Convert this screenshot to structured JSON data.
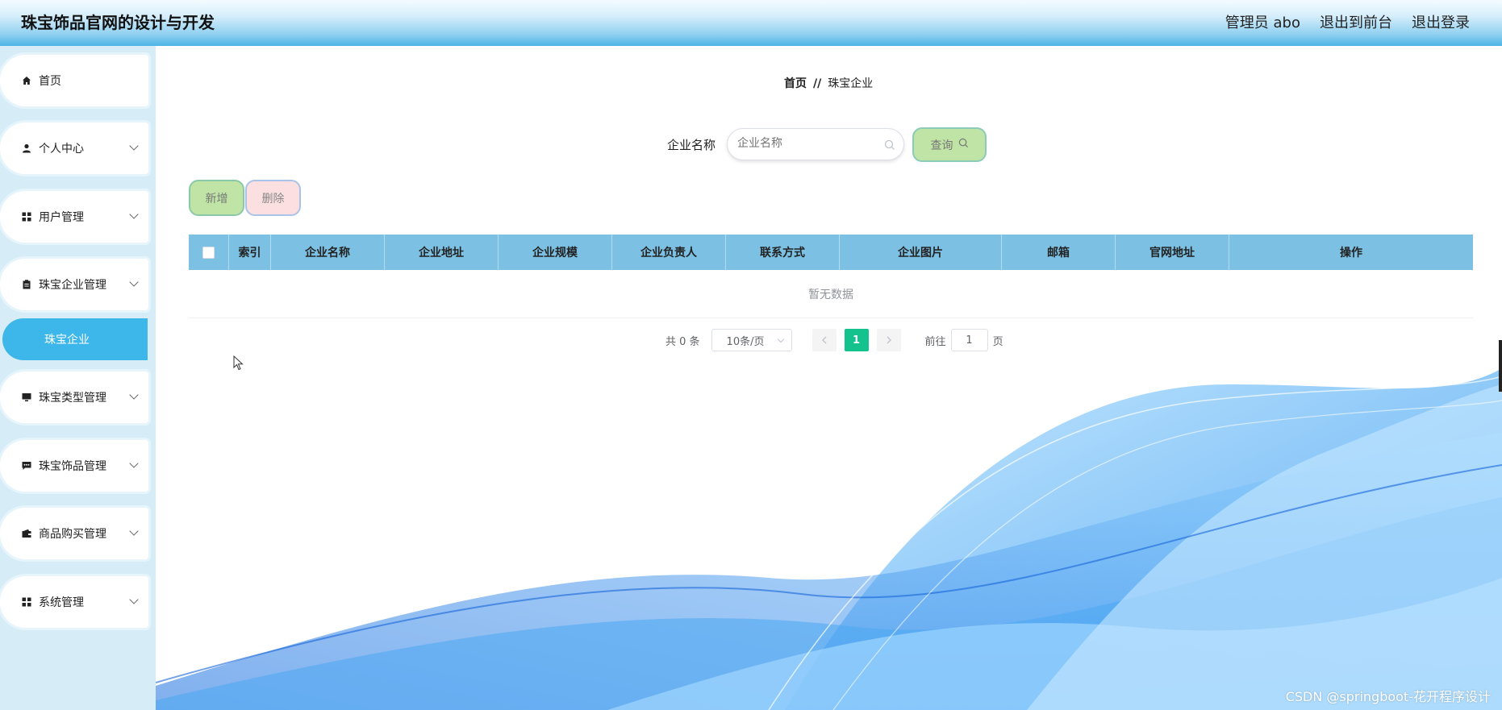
{
  "header": {
    "title": "珠宝饰品官网的设计与开发",
    "admin_label": "管理员 abo",
    "to_front": "退出到前台",
    "logout": "退出登录"
  },
  "sidebar": {
    "items": [
      {
        "label": "首页",
        "icon": "home-icon"
      },
      {
        "label": "个人中心",
        "icon": "user-icon"
      },
      {
        "label": "用户管理",
        "icon": "grid-icon"
      },
      {
        "label": "珠宝企业管理",
        "icon": "clipboard-icon"
      },
      {
        "label": "珠宝类型管理",
        "icon": "monitor-icon"
      },
      {
        "label": "珠宝饰品管理",
        "icon": "chat-icon"
      },
      {
        "label": "商品购买管理",
        "icon": "wallet-icon"
      },
      {
        "label": "系统管理",
        "icon": "grid-icon"
      }
    ],
    "active_sub": "珠宝企业"
  },
  "breadcrumb": {
    "home": "首页",
    "separator": "//",
    "current": "珠宝企业"
  },
  "search": {
    "label": "企业名称",
    "placeholder": "企业名称",
    "query_label": "查询"
  },
  "actions": {
    "add": "新增",
    "delete": "删除"
  },
  "table": {
    "columns": [
      "索引",
      "企业名称",
      "企业地址",
      "企业规模",
      "企业负责人",
      "联系方式",
      "企业图片",
      "邮箱",
      "官网地址",
      "操作"
    ],
    "empty_text": "暂无数据"
  },
  "pagination": {
    "total": "共 0 条",
    "page_size": "10条/页",
    "current_page": "1",
    "goto_prefix": "前往",
    "goto_value": "1",
    "goto_suffix": "页"
  },
  "watermark": "CSDN @springboot-花开程序设计",
  "colors": {
    "accent": "#3db6ea",
    "table_header": "#7cc1e3",
    "page_active": "#13c28c"
  }
}
